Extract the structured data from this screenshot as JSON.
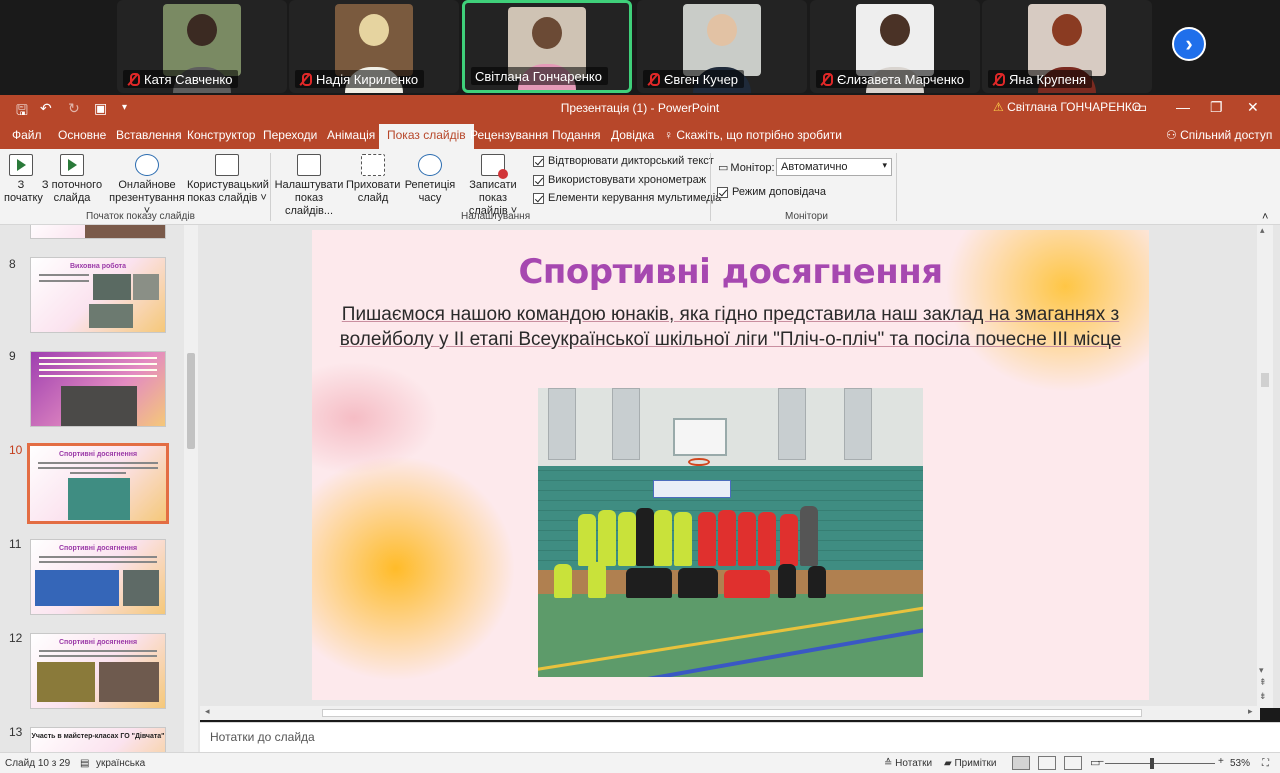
{
  "zoom": {
    "participants": [
      {
        "name": "Катя Савченко",
        "muted": true
      },
      {
        "name": "Надія Кириленко",
        "muted": true
      },
      {
        "name": "Світлана Гончаренко",
        "muted": false,
        "speaking": true
      },
      {
        "name": "Євген Кучер",
        "muted": true
      },
      {
        "name": "Єлизавета Марченко",
        "muted": true
      },
      {
        "name": "Яна Крупеня",
        "muted": true
      }
    ],
    "next_icon": "chevron-right-icon"
  },
  "titlebar": {
    "title": "Презентація (1)  -  PowerPoint",
    "user": "Світлана ГОНЧАРЕНКО",
    "warning_icon": "⚠"
  },
  "tabs": [
    "Файл",
    "Основне",
    "Вставлення",
    "Конструктор",
    "Переходи",
    "Анімація",
    "Показ слайдів",
    "Рецензування",
    "Подання",
    "Довідка"
  ],
  "active_tab": "Показ слайдів",
  "tell_me": "Скажіть, що потрібно зробити",
  "share": "Спільний доступ",
  "ribbon": {
    "from_start": [
      "З",
      "початку"
    ],
    "from_current": [
      "З поточного",
      "слайда"
    ],
    "online": [
      "Онлайнове",
      "презентування ˅"
    ],
    "custom": [
      "Користувацький",
      "показ слайдів ˅"
    ],
    "group_start": "Початок показу слайдів",
    "setup": [
      "Налаштувати",
      "показ слайдів..."
    ],
    "hide": [
      "Приховати",
      "слайд"
    ],
    "rehearse": [
      "Репетиція",
      "часу"
    ],
    "record": [
      "Записати показ",
      "слайдів ˅"
    ],
    "cb_narration": "Відтворювати дикторський текст",
    "cb_timings": "Використовувати хронометраж",
    "cb_media": "Елементи керування мультимедіа",
    "group_setup": "Налаштування",
    "monitor_label": "Монітор:",
    "monitor_value": "Автоматично",
    "cb_presenter": "Режим доповідача",
    "group_monitors": "Монітори"
  },
  "thumbnails": [
    {
      "num": "8",
      "title": "Виховна робота"
    },
    {
      "num": "9",
      "title": ""
    },
    {
      "num": "10",
      "title": "Спортивні досягнення",
      "current": true
    },
    {
      "num": "11",
      "title": "Спортивні досягнення"
    },
    {
      "num": "12",
      "title": "Спортивні досягнення"
    },
    {
      "num": "13",
      "title": "Участь в майстер-класах ГО \"Дівчата\""
    }
  ],
  "slide": {
    "title": "Спортивні досягнення",
    "subtitle": "Пишаємося нашою командою юнаків, яка гідно представила наш заклад на змаганнях з волейболу у ІІ етапі Всеукраїнської шкільної ліги \"Пліч-о-пліч\" та посіла почесне ІІІ місце"
  },
  "notes_placeholder": "Нотатки до слайда",
  "status": {
    "slide_info": "Слайд 10 з 29",
    "language": "українська",
    "notes": "Нотатки",
    "comments": "Примітки",
    "zoom": "53%"
  }
}
